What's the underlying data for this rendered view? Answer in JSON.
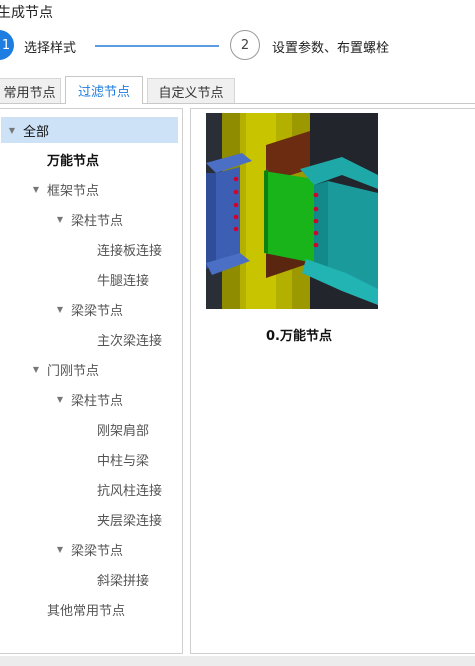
{
  "window": {
    "title": "生成节点"
  },
  "steps": [
    {
      "number": "1",
      "label": "选择样式"
    },
    {
      "number": "2",
      "label": "设置参数、布置螺栓"
    }
  ],
  "tabs": [
    {
      "label": "常用节点"
    },
    {
      "label": "过滤节点"
    },
    {
      "label": "自定义节点"
    }
  ],
  "tree": {
    "items": [
      {
        "label": "全部"
      },
      {
        "label": "万能节点"
      },
      {
        "label": "框架节点"
      },
      {
        "label": "梁柱节点"
      },
      {
        "label": "连接板连接"
      },
      {
        "label": "牛腿连接"
      },
      {
        "label": "梁梁节点"
      },
      {
        "label": "主次梁连接"
      },
      {
        "label": "门刚节点"
      },
      {
        "label": "梁柱节点"
      },
      {
        "label": "刚架肩部"
      },
      {
        "label": "中柱与梁"
      },
      {
        "label": "抗风柱连接"
      },
      {
        "label": "夹层梁连接"
      },
      {
        "label": "梁梁节点"
      },
      {
        "label": "斜梁拼接"
      },
      {
        "label": "其他常用节点"
      }
    ]
  },
  "preview": {
    "caption": "0.万能节点"
  }
}
